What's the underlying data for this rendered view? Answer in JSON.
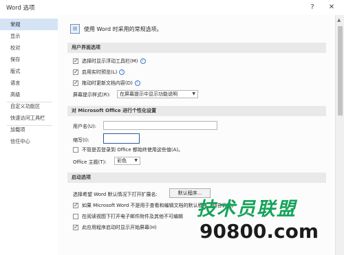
{
  "window": {
    "title": "Word 选项",
    "help_glyph": "?",
    "close_glyph": "✕"
  },
  "sidebar": {
    "items": [
      {
        "label": "常规",
        "active": true
      },
      {
        "label": "显示"
      },
      {
        "label": "校对"
      },
      {
        "label": "保存"
      },
      {
        "label": "版式"
      },
      {
        "label": "语言"
      },
      {
        "label": "高级"
      },
      {
        "label": "自定义功能区"
      },
      {
        "label": "快速访问工具栏"
      },
      {
        "label": "加载项"
      },
      {
        "label": "信任中心"
      }
    ]
  },
  "main": {
    "intro": "使用 Word 时采用的常规选项。",
    "ui_section": {
      "title": "用户界面选项",
      "options": [
        {
          "label": "选择时显示浮动工具栏(M)",
          "checked": true
        },
        {
          "label": "启用实时预览(L)",
          "checked": true
        },
        {
          "label": "拖动时更新文档内容(D)",
          "checked": true
        }
      ],
      "tooltip_label": "屏幕提示样式(R):",
      "tooltip_value": "在屏幕提示中显示功能说明"
    },
    "personal_section": {
      "title": "对 Microsoft Office 进行个性化设置",
      "username_label": "用户名(U):",
      "username_value": "",
      "initials_label": "缩写(I):",
      "initials_value": "",
      "always_use_label": "不管是否登录到 Office 都始终使用这些值(A)。",
      "always_use_checked": false,
      "theme_label": "Office 主题(T):",
      "theme_value": "彩色"
    },
    "startup_section": {
      "title": "启动选项",
      "default_ext_label": "选择希望 Word 默认情况下打开扩展名:",
      "default_programs_button": "默认程序...",
      "options": [
        {
          "label": "如果 Microsoft Word 不是用于查看和编辑文档的默认程序，则告诉我。",
          "checked": true
        },
        {
          "label": "在阅读视图下打开电子邮件附件及其他不可编辑",
          "checked": false
        },
        {
          "label": "此应用程序启动时显示开始屏幕(H)",
          "checked": true
        }
      ]
    }
  },
  "watermark": {
    "line1": "技术员联盟",
    "line2": "90800.com"
  },
  "colors": {
    "active_nav": "#d5e4f5",
    "section_bg": "#e9e9e9",
    "focus_border": "#2b579a",
    "info_icon": "#3a78c8",
    "watermark_green": "#15a35a"
  }
}
